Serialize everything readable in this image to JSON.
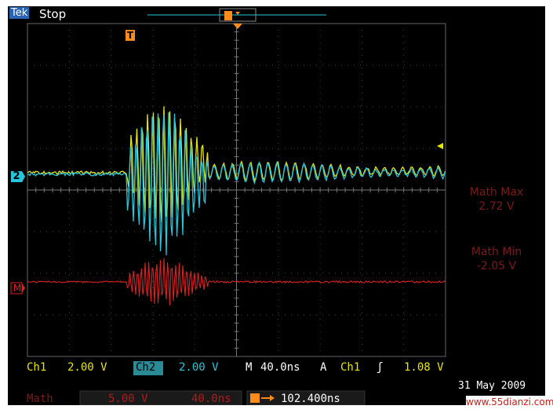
{
  "header": {
    "brand": "Tek",
    "state": "Stop",
    "trigger_marker": "T"
  },
  "markers": {
    "trigger_t": "T",
    "ch2": "2",
    "math": "M"
  },
  "measurements": {
    "max_label": "Math Max",
    "max_value": "2.72 V",
    "min_label": "Math Min",
    "min_value": "-2.05 V"
  },
  "status_row1": {
    "ch1_label": "Ch1",
    "ch1_scale": "2.00 V",
    "ch2_label": "Ch2",
    "ch2_scale": "2.00 V",
    "timebase_label": "M",
    "timebase": "40.0ns",
    "trigger_mode": "A",
    "trigger_source": "Ch1",
    "trigger_slope": "ʃ",
    "trigger_level": "1.08 V"
  },
  "status_row2": {
    "math_label": "Math",
    "math_scale": "5.00 V",
    "math_time": "40.0ns",
    "trigger_pos_icon": "T",
    "trigger_pos": "102.400ns"
  },
  "date": "31 May 2009",
  "watermark": "www.55dianzi.com",
  "colors": {
    "ch1": "#e6e600",
    "ch2": "#26c6da",
    "math": "#dd2222",
    "trigger": "#ff8c1a",
    "grid": "#555555"
  }
}
